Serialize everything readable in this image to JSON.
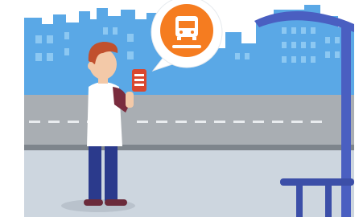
{
  "illustration": {
    "subject": "person-at-bus-stop",
    "icons": [
      "bus-icon",
      "phone-icon",
      "speech-bubble-icon"
    ]
  },
  "colors": {
    "sky": "#ffffff",
    "city": "#5aa8e6",
    "city_windows": "#8cc8f2",
    "road": "#a9aeb3",
    "road_line": "#e9ecef",
    "curb": "#7e858c",
    "sidewalk": "#cdd6df",
    "bubble": "#ffffff",
    "bus_circle": "#f57c20",
    "shelter": "#4a5fc1",
    "shelter_dark": "#3c4fa8",
    "hair": "#c1502d",
    "skin": "#f3c9a8",
    "shirt": "#ffffff",
    "sleeve": "#7a2c3e",
    "pants": "#2b3a8c",
    "shoes": "#6b2b3b",
    "phone": "#d9472f",
    "shadow": "#b9c2cc"
  }
}
